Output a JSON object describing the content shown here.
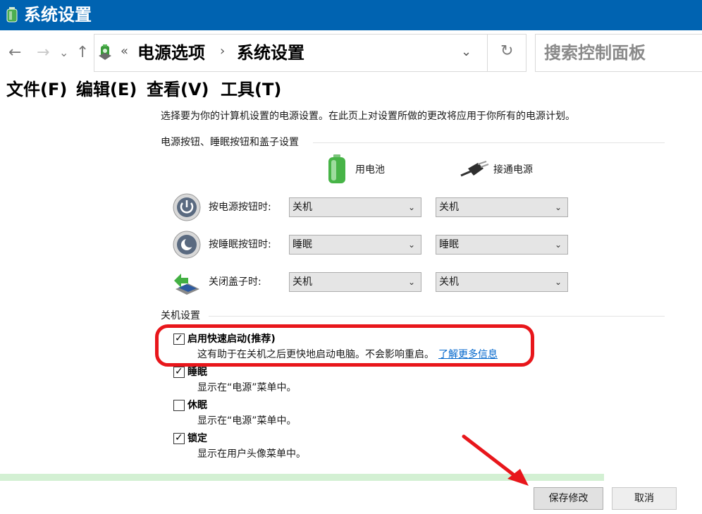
{
  "window": {
    "title": "系统设置"
  },
  "nav": {
    "back": "←",
    "forward": "→",
    "recent": "⌄",
    "up": "↑",
    "chev_left": "«",
    "crumbs": [
      "电源选项",
      "系统设置"
    ],
    "crumb_sep": "›",
    "dropdown": "⌄",
    "refresh": "↻",
    "search_placeholder": "搜索控制面板"
  },
  "menu": [
    "文件(F)",
    "编辑(E)",
    "查看(V)",
    "工具(T)"
  ],
  "intro": "选择要为你的计算机设置的电源设置。在此页上对设置所做的更改将应用于你所有的电源计划。",
  "buttons_section": {
    "title": "电源按钮、睡眠按钮和盖子设置",
    "col_battery": "用电池",
    "col_power": "接通电源",
    "rows": [
      {
        "label": "按电源按钮时:",
        "battery": "关机",
        "power": "关机",
        "icon": "power-button-icon"
      },
      {
        "label": "按睡眠按钮时:",
        "battery": "睡眠",
        "power": "睡眠",
        "icon": "sleep-button-icon"
      },
      {
        "label": "关闭盖子时:",
        "battery": "关机",
        "power": "关机",
        "icon": "laptop-lid-icon"
      }
    ]
  },
  "shutdown_section": {
    "title": "关机设置",
    "items": [
      {
        "label": "启用快速启动(推荐)",
        "desc": "这有助于在关机之后更快地启动电脑。不会影响重启。",
        "link": "了解更多信息",
        "checked": true
      },
      {
        "label": "睡眠",
        "desc": "显示在“电源”菜单中。",
        "checked": true
      },
      {
        "label": "休眠",
        "desc": "显示在“电源”菜单中。",
        "checked": false
      },
      {
        "label": "锁定",
        "desc": "显示在用户头像菜单中。",
        "checked": true
      }
    ]
  },
  "footer": {
    "save": "保存修改",
    "cancel": "取消"
  },
  "colors": {
    "titlebar": "#0063b1",
    "highlight": "#e8161b",
    "link": "#0066cc",
    "strip": "#d3f0d3"
  }
}
